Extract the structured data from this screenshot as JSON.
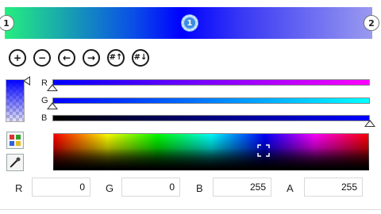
{
  "gradient": {
    "stops": [
      {
        "label": "1",
        "color": "#25ee7f"
      },
      {
        "label": "1",
        "color": "#0000ff",
        "selected": true
      },
      {
        "label": "2",
        "color": "#9a9af0"
      }
    ]
  },
  "toolbar": {
    "buttons": [
      {
        "name": "add-stop",
        "icon": "plus-icon",
        "glyph": "+"
      },
      {
        "name": "remove-stop",
        "icon": "minus-icon",
        "glyph": "−"
      },
      {
        "name": "move-left",
        "icon": "arrow-left-icon",
        "glyph": "←"
      },
      {
        "name": "move-right",
        "icon": "arrow-right-icon",
        "glyph": "→"
      },
      {
        "name": "distribute-up",
        "icon": "hash-up-icon",
        "glyph": "#↑"
      },
      {
        "name": "distribute-down",
        "icon": "hash-down-icon",
        "glyph": "#↓"
      }
    ]
  },
  "sliders": {
    "r_label": "R",
    "g_label": "G",
    "b_label": "B",
    "r_fraction": 0,
    "g_fraction": 0,
    "b_fraction": 1
  },
  "fields": {
    "r": {
      "label": "R",
      "value": "0"
    },
    "g": {
      "label": "G",
      "value": "0"
    },
    "b": {
      "label": "B",
      "value": "255"
    },
    "a": {
      "label": "A",
      "value": "255"
    }
  },
  "colors": {
    "current": "#0000ff"
  }
}
